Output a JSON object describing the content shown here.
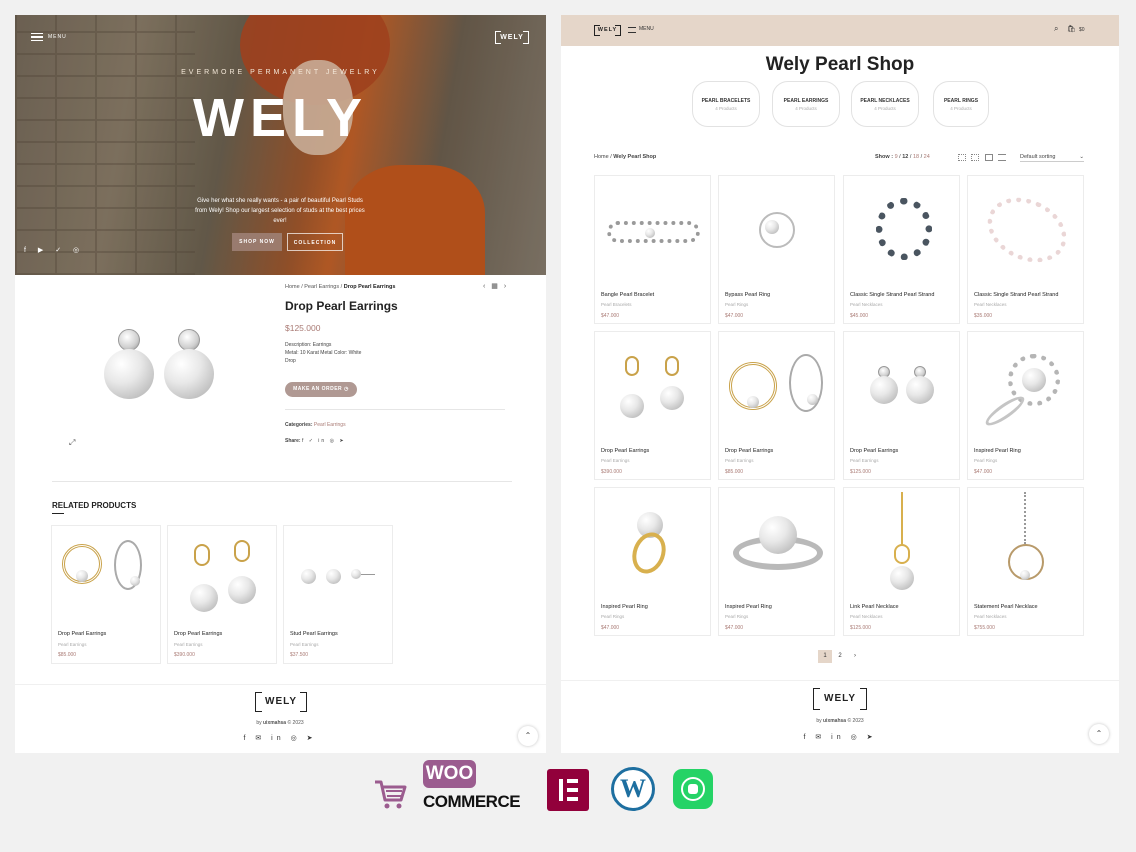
{
  "left": {
    "hero": {
      "menu_label": "MENU",
      "logo": "WELY",
      "tagline": "EVERMORE PERMANENT JEWELRY",
      "title": "WELY",
      "description": "Give her what she really wants - a pair of beautiful Pearl Studs from Wely! Shop our largest selection of studs at the best prices ever!",
      "shop_now": "SHOP NOW",
      "collection": "COLLECTION",
      "social": "f ▶ ✓ ◎"
    },
    "product": {
      "breadcrumb_home": "Home",
      "breadcrumb_cat": "Pearl Earrings",
      "breadcrumb_current": "Drop Pearl Earrings",
      "title": "Drop Pearl Earrings",
      "price": "$125.000",
      "desc_line1": "Description: Earrings",
      "desc_line2": "Metal: 10 Karat Metal Color: White",
      "desc_line3": "Drop",
      "order_button": "MAKE AN ORDER ◷",
      "categories_label": "Categories:",
      "categories_value": "Pearl Earrings",
      "share_label": "Share:",
      "share_icons": "f ✓ in ◎ ➤"
    },
    "related": {
      "title": "RELATED PRODUCTS",
      "items": [
        {
          "name": "Drop Pearl Earrings",
          "category": "Pearl Earrings",
          "price": "$85.000"
        },
        {
          "name": "Drop Pearl Earrings",
          "category": "Pearl Earrings",
          "price": "$390.000"
        },
        {
          "name": "Stud Pearl Earrings",
          "category": "Pearl Earrings",
          "price": "$37.500"
        }
      ]
    },
    "footer": {
      "logo": "WELY",
      "copyright_prefix": "by",
      "copyright_author": "uixmahsa",
      "copyright_year": "© 2023",
      "social": "f ✉ in ◎ ➤"
    }
  },
  "right": {
    "header": {
      "logo": "WELY",
      "menu_label": "MENU",
      "cart_total": "$0",
      "cart_count": "0"
    },
    "title": "Wely Pearl Shop",
    "categories": [
      {
        "name": "PEARL BRACELETS",
        "count": "4 Products"
      },
      {
        "name": "PEARL EARRINGS",
        "count": "4 Products"
      },
      {
        "name": "PEARL NECKLACES",
        "count": "4 Products"
      },
      {
        "name": "PEARL RINGS",
        "count": "4 Products"
      }
    ],
    "breadcrumb_home": "Home",
    "breadcrumb_current": "Wely Pearl Shop",
    "show_label": "Show :",
    "show_options": [
      "9",
      "12",
      "18",
      "24"
    ],
    "sorting": "Default sorting",
    "products": [
      {
        "name": "Bangle Pearl Bracelet",
        "category": "Pearl Bracelets",
        "price": "$47.000"
      },
      {
        "name": "Bypass Pearl Ring",
        "category": "Pearl Rings",
        "price": "$47.000"
      },
      {
        "name": "Classic Single Strand Pearl Strand",
        "category": "Pearl Necklaces",
        "price": "$45.000"
      },
      {
        "name": "Classic Single Strand Pearl Strand",
        "category": "Pearl Necklaces",
        "price": "$35.000"
      },
      {
        "name": "Drop Pearl Earrings",
        "category": "Pearl Earrings",
        "price": "$390.000"
      },
      {
        "name": "Drop Pearl Earrings",
        "category": "Pearl Earrings",
        "price": "$85.000"
      },
      {
        "name": "Drop Pearl Earrings",
        "category": "Pearl Earrings",
        "price": "$125.000"
      },
      {
        "name": "Inspired Pearl Ring",
        "category": "Pearl Rings",
        "price": "$47.000"
      },
      {
        "name": "Inspired Pearl Ring",
        "category": "Pearl Rings",
        "price": "$47.000"
      },
      {
        "name": "Inspired Pearl Ring",
        "category": "Pearl Rings",
        "price": "$47.000"
      },
      {
        "name": "Link Pearl Necklace",
        "category": "Pearl Necklaces",
        "price": "$125.000"
      },
      {
        "name": "Statement Pearl Necklace",
        "category": "Pearl Necklaces",
        "price": "$755.000"
      }
    ],
    "pagination": {
      "current": "1",
      "next_page": "2",
      "next_arrow": "›"
    },
    "footer": {
      "logo": "WELY",
      "copyright_prefix": "by",
      "copyright_author": "uixmahsa",
      "copyright_year": "© 2023",
      "social": "f ✉ in ◎ ➤"
    }
  },
  "badges": {
    "woo": "WOO",
    "commerce": "COMMERCE"
  },
  "colors": {
    "accent": "#a97a74",
    "header_bg": "#e5d6c9",
    "button": "#b09993"
  }
}
